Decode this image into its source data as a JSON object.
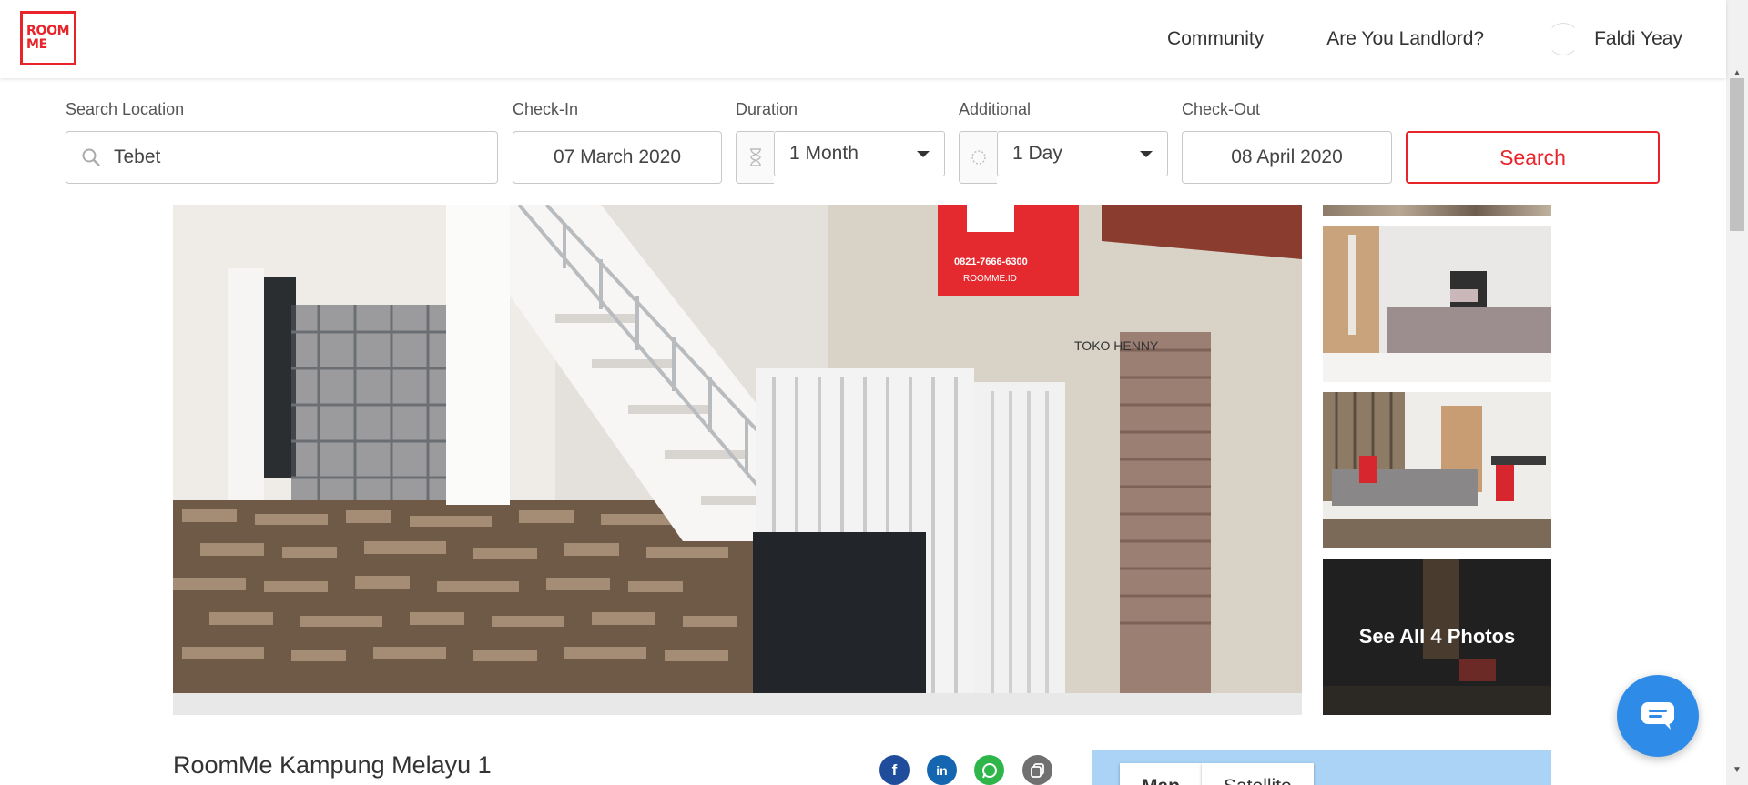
{
  "brand": {
    "logo_line1": "ROOM",
    "logo_line2": "ME",
    "accent": "#e8242b"
  },
  "nav": {
    "community": "Community",
    "landlord": "Are You Landlord?",
    "user_name": "Faldi Yeay"
  },
  "search": {
    "location_label": "Search Location",
    "location_value": "Tebet",
    "checkin_label": "Check-In",
    "checkin_value": "07 March 2020",
    "duration_label": "Duration",
    "duration_value": "1 Month",
    "additional_label": "Additional",
    "additional_value": "1 Day",
    "checkout_label": "Check-Out",
    "checkout_value": "08 April 2020",
    "search_button": "Search"
  },
  "gallery": {
    "see_all_label": "See All 4 Photos",
    "sign_text": "0821-7666-6300",
    "sign_site": "ROOMME.ID",
    "shop_text": "TOKO HENNY"
  },
  "listing": {
    "title": "RoomMe Kampung Melayu 1"
  },
  "share": {
    "facebook": "f",
    "linkedin": "in",
    "whatsapp": "whatsapp",
    "copy": "copy"
  },
  "map": {
    "tab_map": "Map",
    "tab_satellite": "Satellite"
  },
  "colors": {
    "chat": "#2e8ce8",
    "facebook": "#1f4d9b",
    "linkedin": "#1466b0",
    "whatsapp": "#2fb64a",
    "map_water": "#aad3f5"
  }
}
